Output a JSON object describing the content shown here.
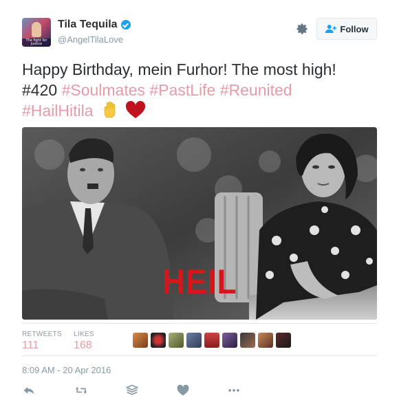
{
  "tweet": {
    "author_name": "Tila Tequila",
    "author_handle": "@AngelTilaLove",
    "avatar_caption": "The fight for justice",
    "follow_label": "Follow",
    "text_plain_1": "Happy Birthday, mein Furhor! The most high!",
    "text_plain_2": "#420",
    "hashtags": [
      "#Soulmates",
      "#PastLife",
      "#Reunited",
      "#HailHitila"
    ],
    "emoji": [
      "raised-hand",
      "red-heart"
    ],
    "image_overlay_text": "HEIL",
    "stats": {
      "retweets_label": "RETWEETS",
      "retweets_value": "111",
      "likes_label": "LIKES",
      "likes_value": "168"
    },
    "liker_avatar_count": 9,
    "timestamp": "8:09 AM - 20 Apr 2016"
  },
  "colors": {
    "hashtag": "#e99aa8",
    "verified": "#1da1f2",
    "overlay_text": "#d7161c",
    "muted": "#8899a6"
  },
  "icons": [
    "gear-icon",
    "follow-user-icon",
    "reply-icon",
    "retweet-icon",
    "add-to-moment-icon",
    "like-icon",
    "more-icon"
  ]
}
